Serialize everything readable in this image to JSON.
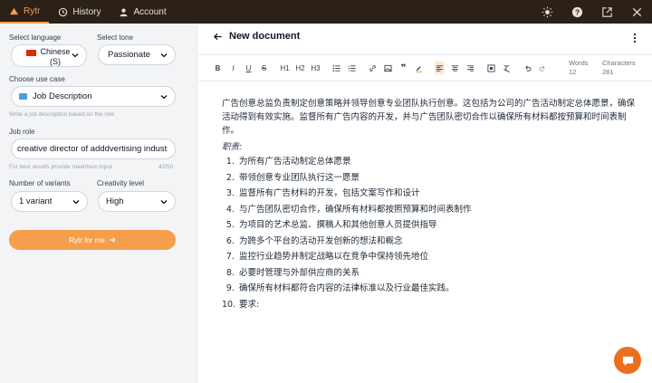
{
  "topbar": {
    "tabs": [
      {
        "label": "Rytr",
        "active": true
      },
      {
        "label": "History",
        "active": false
      },
      {
        "label": "Account",
        "active": false
      }
    ],
    "icons": [
      "sun-icon",
      "help-icon",
      "external-link-icon",
      "close-icon"
    ]
  },
  "sidebar": {
    "language": {
      "label": "Select language",
      "value": "Chinese (S)",
      "flag": "china-flag"
    },
    "tone": {
      "label": "Select tone",
      "value": "Passionate"
    },
    "use_case": {
      "label": "Choose use case",
      "value": "Job Description",
      "hint": "Write a job description based on the role"
    },
    "job_role": {
      "label": "Job role",
      "value": "creative director of adddvertising industry",
      "hint": "For best results provide maximum input",
      "counter": "42/50"
    },
    "variants": {
      "label": "Number of variants",
      "value": "1 variant"
    },
    "creativity": {
      "label": "Creativity level",
      "value": "High"
    },
    "button": "Rytr for me"
  },
  "editor": {
    "title": "New document",
    "toolbar": [
      "B",
      "I",
      "U",
      "S",
      "H1",
      "H2",
      "H3"
    ],
    "words_label": "Words",
    "words": "12",
    "chars_label": "Characters",
    "chars": "281",
    "intro": "广告创意总监负责制定创意策略并领导创意专业团队执行创意。这包括为公司的广告活动制定总体愿景，确保活动得到有效实施。监督所有广告内容的开发，并与广告团队密切合作以确保所有材料都按预算和时间表制作。",
    "duties_label": "职责:",
    "items": [
      {
        "n": "1.",
        "text": "为所有广告活动制定总体愿景"
      },
      {
        "n": "2.",
        "text": "带领创意专业团队执行这一愿景"
      },
      {
        "n": "3.",
        "text": "监督所有广告材料的开发，包括文案写作和设计"
      },
      {
        "n": "4.",
        "text": "与广告团队密切合作，确保所有材料都按照预算和时间表制作"
      },
      {
        "n": "5.",
        "text": "为项目的艺术总监、撰稿人和其他创意人员提供指导"
      },
      {
        "n": "6.",
        "text": "为跨多个平台的活动开发创新的想法和概念"
      },
      {
        "n": "7.",
        "text": "监控行业趋势并制定战略以在竞争中保持领先地位"
      },
      {
        "n": "8.",
        "text": "必要时管理与外部供应商的关系"
      },
      {
        "n": "9.",
        "text": "确保所有材料都符合内容的法律标准以及行业最佳实践。"
      },
      {
        "n": "10.",
        "text": "要求:"
      }
    ]
  },
  "colors": {
    "accent": "#f59e4c",
    "topbar": "#2b2118",
    "chat": "#ec6e1f"
  }
}
